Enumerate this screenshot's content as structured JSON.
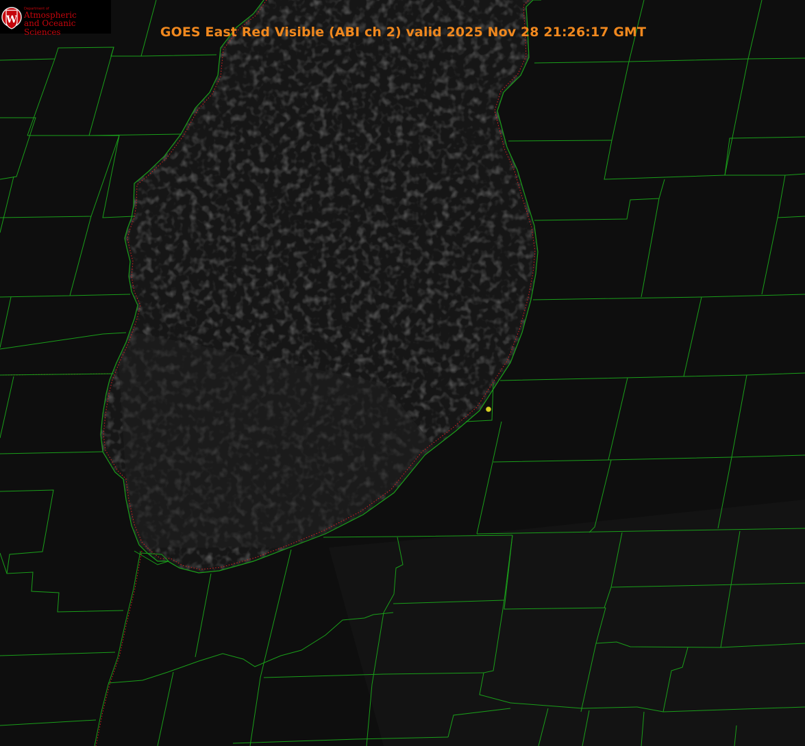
{
  "title": {
    "product": "GOES East Red Visible (ABI ch 2)",
    "valid_label": "valid",
    "valid_time": "2025 Nov 28 21:26:17 GMT"
  },
  "logo": {
    "shield_letter": "W",
    "department": "Department of",
    "line1": "Atmospheric",
    "line2": "and Oceanic Sciences"
  },
  "colors": {
    "background": "#0c0c0c",
    "lake": "#171717",
    "county_lines": "#1aa01a",
    "lake_shoreline": "#1aa01a",
    "state_border": "#e02020",
    "title": "#f0881e",
    "logo_red": "#c5050c",
    "marker": "#d8d020"
  }
}
